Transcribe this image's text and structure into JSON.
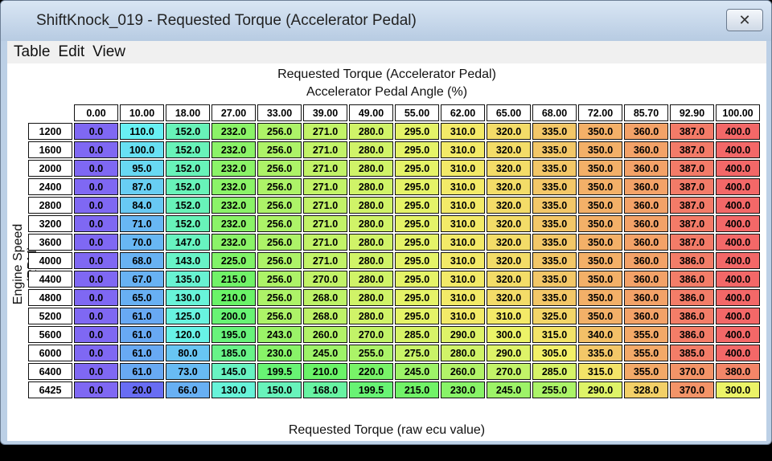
{
  "window": {
    "title": "ShiftKnock_019 - Requested Torque (Accelerator Pedal)",
    "close_label": "✕"
  },
  "menu": {
    "items": [
      "Table",
      "Edit",
      "View"
    ]
  },
  "table": {
    "title": "Requested Torque (Accelerator Pedal)",
    "x_axis_label": "Accelerator Pedal Angle (%)",
    "y_axis_label": "Engine Speed (RPM)",
    "footer": "Requested Torque (raw ecu value)",
    "columns": [
      "0.00",
      "10.00",
      "18.00",
      "27.00",
      "33.00",
      "39.00",
      "49.00",
      "55.00",
      "62.00",
      "65.00",
      "68.00",
      "72.00",
      "85.70",
      "92.90",
      "100.00"
    ],
    "rows": [
      {
        "rpm": "1200",
        "values": [
          "0.0",
          "110.0",
          "152.0",
          "232.0",
          "256.0",
          "271.0",
          "280.0",
          "295.0",
          "310.0",
          "320.0",
          "335.0",
          "350.0",
          "360.0",
          "387.0",
          "400.0"
        ]
      },
      {
        "rpm": "1600",
        "values": [
          "0.0",
          "100.0",
          "152.0",
          "232.0",
          "256.0",
          "271.0",
          "280.0",
          "295.0",
          "310.0",
          "320.0",
          "335.0",
          "350.0",
          "360.0",
          "387.0",
          "400.0"
        ]
      },
      {
        "rpm": "2000",
        "values": [
          "0.0",
          "95.0",
          "152.0",
          "232.0",
          "256.0",
          "271.0",
          "280.0",
          "295.0",
          "310.0",
          "320.0",
          "335.0",
          "350.0",
          "360.0",
          "387.0",
          "400.0"
        ]
      },
      {
        "rpm": "2400",
        "values": [
          "0.0",
          "87.0",
          "152.0",
          "232.0",
          "256.0",
          "271.0",
          "280.0",
          "295.0",
          "310.0",
          "320.0",
          "335.0",
          "350.0",
          "360.0",
          "387.0",
          "400.0"
        ]
      },
      {
        "rpm": "2800",
        "values": [
          "0.0",
          "84.0",
          "152.0",
          "232.0",
          "256.0",
          "271.0",
          "280.0",
          "295.0",
          "310.0",
          "320.0",
          "335.0",
          "350.0",
          "360.0",
          "387.0",
          "400.0"
        ]
      },
      {
        "rpm": "3200",
        "values": [
          "0.0",
          "71.0",
          "152.0",
          "232.0",
          "256.0",
          "271.0",
          "280.0",
          "295.0",
          "310.0",
          "320.0",
          "335.0",
          "350.0",
          "360.0",
          "387.0",
          "400.0"
        ]
      },
      {
        "rpm": "3600",
        "values": [
          "0.0",
          "70.0",
          "147.0",
          "232.0",
          "256.0",
          "271.0",
          "280.0",
          "295.0",
          "310.0",
          "320.0",
          "335.0",
          "350.0",
          "360.0",
          "387.0",
          "400.0"
        ]
      },
      {
        "rpm": "4000",
        "values": [
          "0.0",
          "68.0",
          "143.0",
          "225.0",
          "256.0",
          "271.0",
          "280.0",
          "295.0",
          "310.0",
          "320.0",
          "335.0",
          "350.0",
          "360.0",
          "386.0",
          "400.0"
        ]
      },
      {
        "rpm": "4400",
        "values": [
          "0.0",
          "67.0",
          "135.0",
          "215.0",
          "256.0",
          "270.0",
          "280.0",
          "295.0",
          "310.0",
          "320.0",
          "335.0",
          "350.0",
          "360.0",
          "386.0",
          "400.0"
        ]
      },
      {
        "rpm": "4800",
        "values": [
          "0.0",
          "65.0",
          "130.0",
          "210.0",
          "256.0",
          "268.0",
          "280.0",
          "295.0",
          "310.0",
          "320.0",
          "335.0",
          "350.0",
          "360.0",
          "386.0",
          "400.0"
        ]
      },
      {
        "rpm": "5200",
        "values": [
          "0.0",
          "61.0",
          "125.0",
          "200.0",
          "256.0",
          "268.0",
          "280.0",
          "295.0",
          "310.0",
          "310.0",
          "325.0",
          "350.0",
          "360.0",
          "386.0",
          "400.0"
        ]
      },
      {
        "rpm": "5600",
        "values": [
          "0.0",
          "61.0",
          "120.0",
          "195.0",
          "243.0",
          "260.0",
          "270.0",
          "285.0",
          "290.0",
          "300.0",
          "315.0",
          "340.0",
          "355.0",
          "386.0",
          "400.0"
        ]
      },
      {
        "rpm": "6000",
        "values": [
          "0.0",
          "61.0",
          "80.0",
          "185.0",
          "230.0",
          "245.0",
          "255.0",
          "275.0",
          "280.0",
          "290.0",
          "305.0",
          "335.0",
          "355.0",
          "385.0",
          "400.0"
        ]
      },
      {
        "rpm": "6400",
        "values": [
          "0.0",
          "61.0",
          "73.0",
          "145.0",
          "199.5",
          "210.0",
          "220.0",
          "245.0",
          "260.0",
          "270.0",
          "285.0",
          "315.0",
          "355.0",
          "370.0",
          "380.0"
        ]
      },
      {
        "rpm": "6425",
        "values": [
          "0.0",
          "20.0",
          "66.0",
          "130.0",
          "150.0",
          "168.0",
          "199.5",
          "215.0",
          "230.0",
          "245.0",
          "255.0",
          "290.0",
          "328.0",
          "370.0",
          "300.0"
        ]
      }
    ]
  }
}
